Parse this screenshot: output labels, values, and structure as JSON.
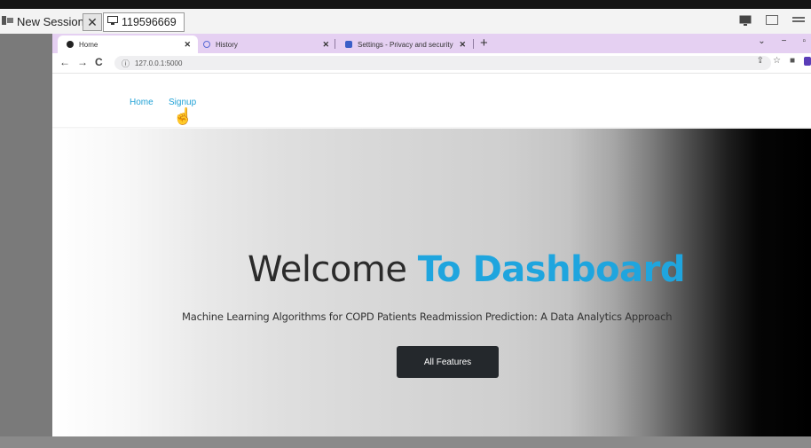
{
  "remote": {
    "session_label": "New Session",
    "session_id": "119596669"
  },
  "browser": {
    "tabs": [
      {
        "label": "Home",
        "active": true
      },
      {
        "label": "History",
        "active": false
      },
      {
        "label": "Settings - Privacy and security",
        "active": false
      }
    ],
    "url": "127.0.0.1:5000"
  },
  "nav": {
    "home": "Home",
    "signup": "Signup"
  },
  "hero": {
    "title_plain": "Welcome",
    "title_highlight": "To Dashboard",
    "subtitle": "Machine Learning Algorithms for COPD Patients Readmission Prediction: A Data Analytics Approach",
    "cta": "All Features"
  },
  "colors": {
    "accent": "#1fa5de",
    "button_bg": "#24282c",
    "tabbar_bg": "#e5d0f2"
  }
}
